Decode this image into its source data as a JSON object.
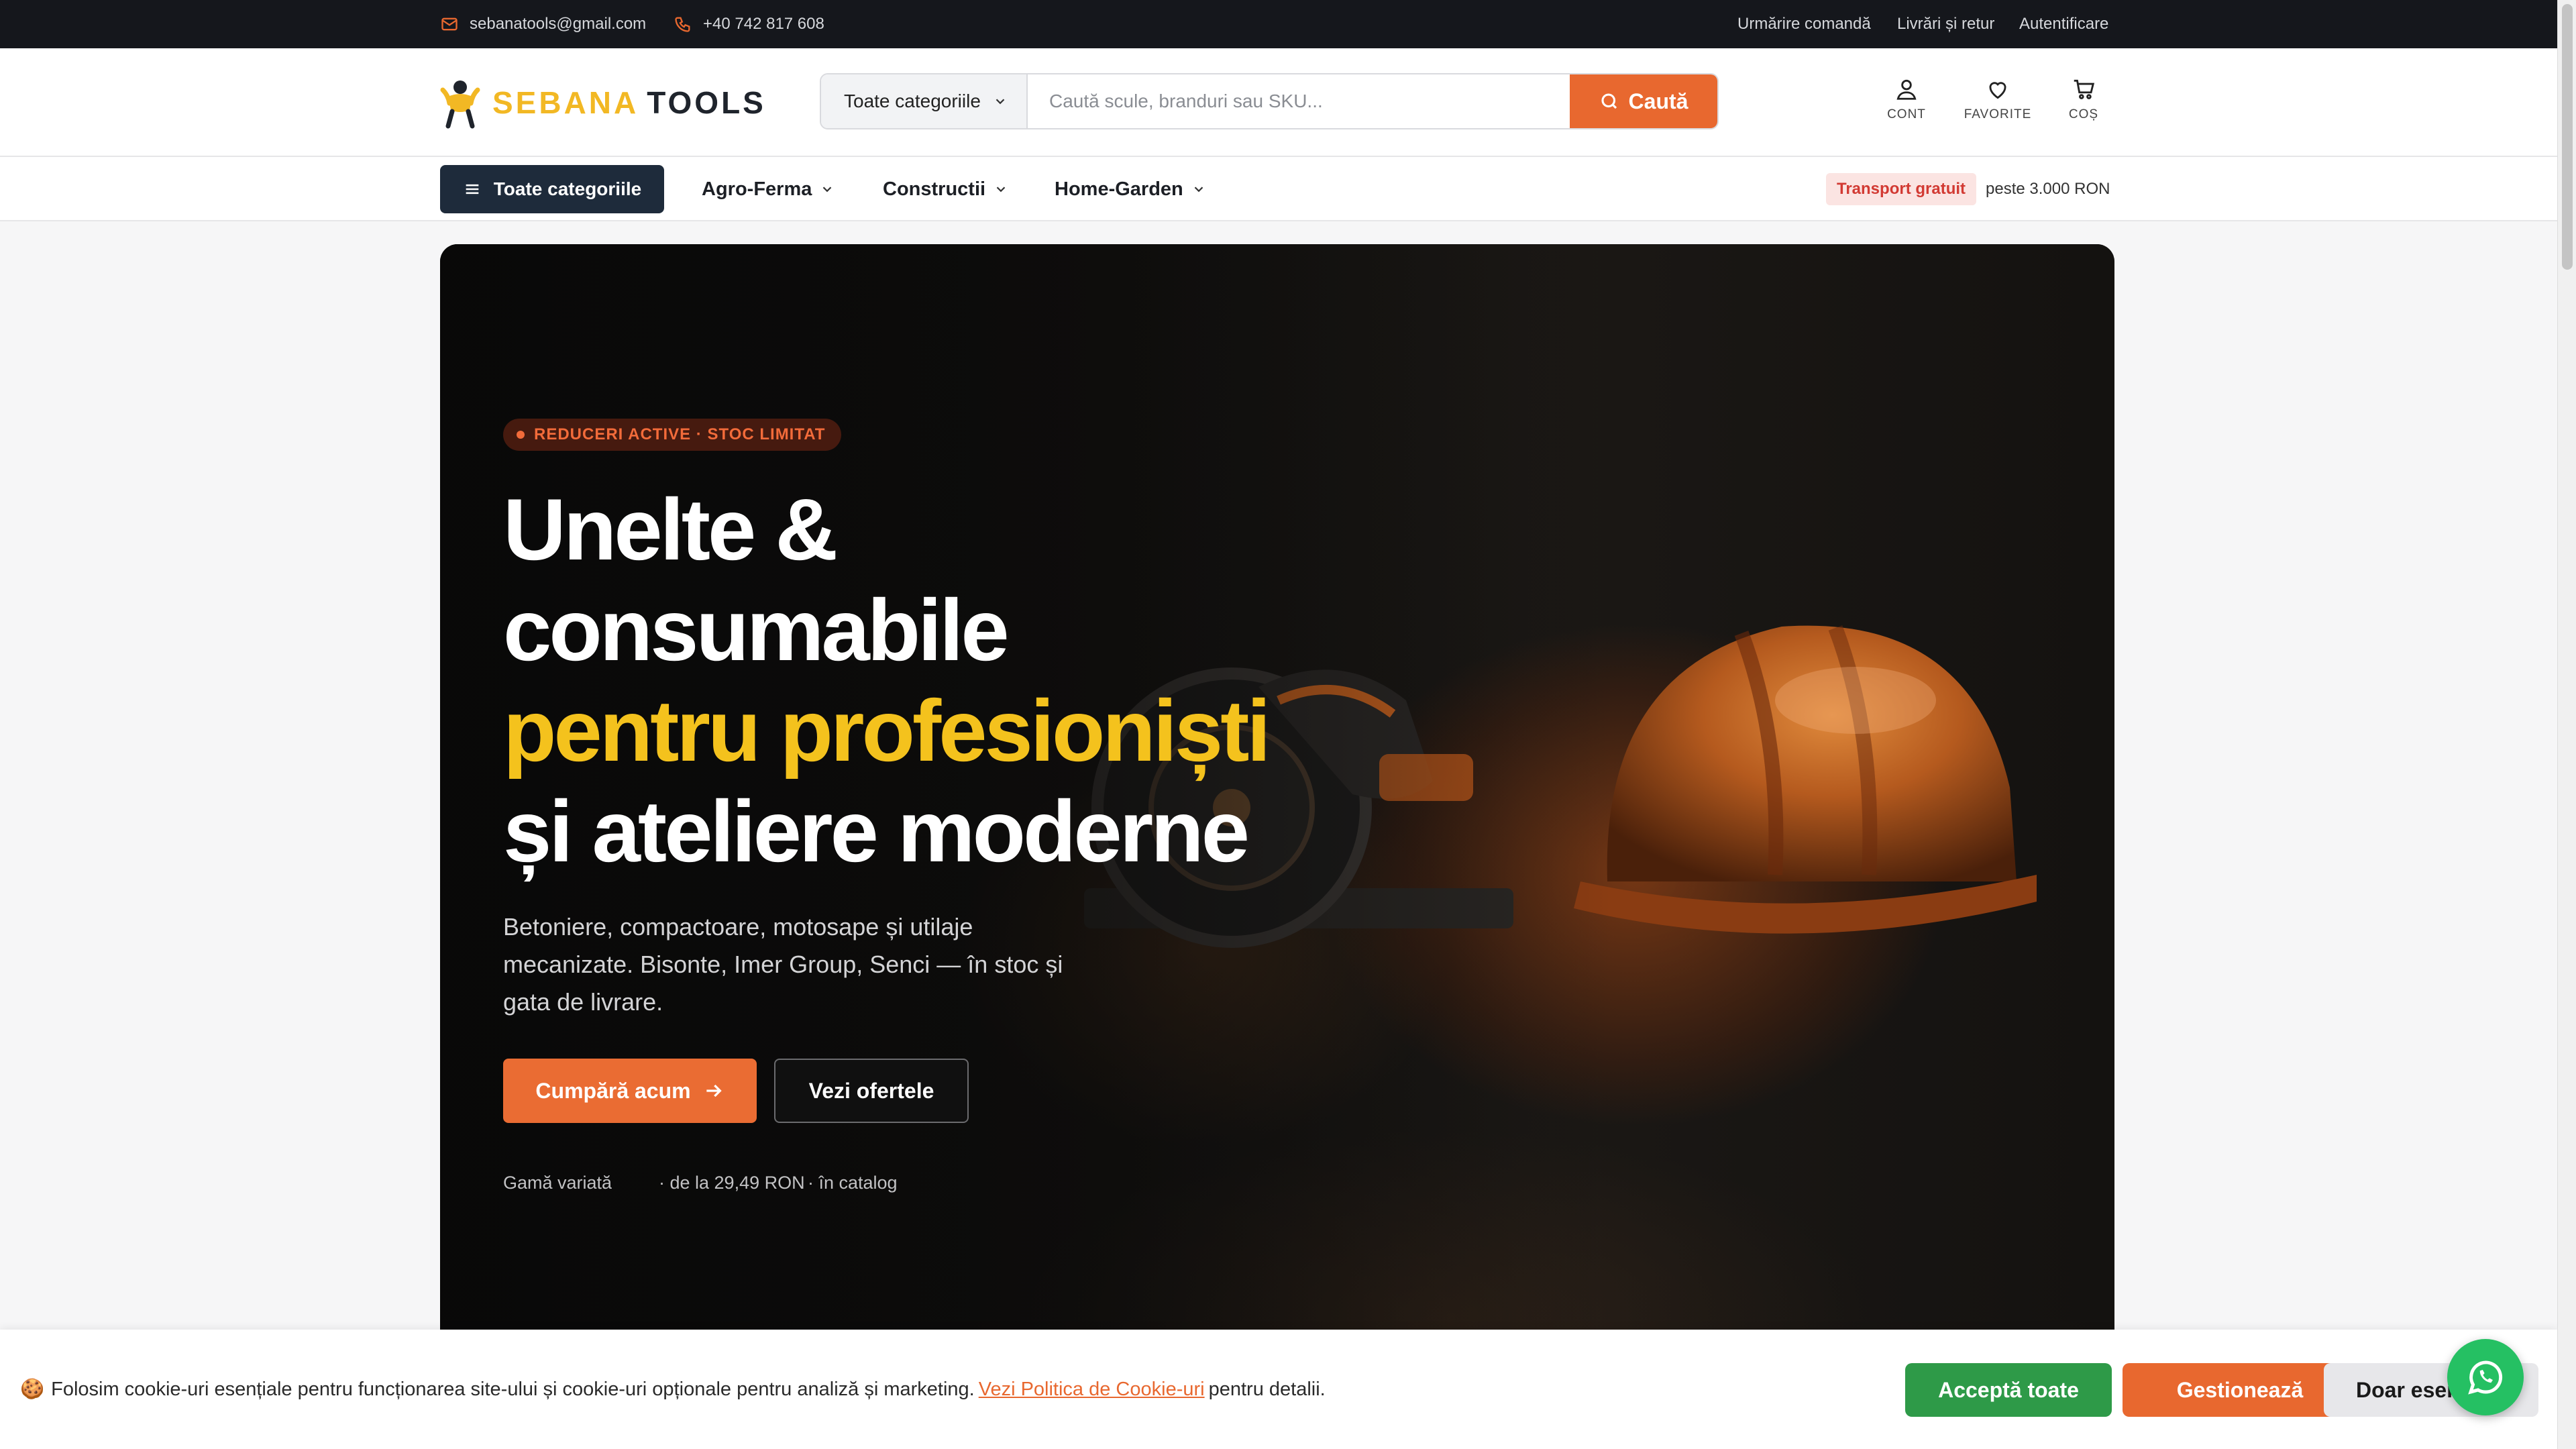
{
  "topbar": {
    "email": "sebanatools@gmail.com",
    "phone": "+40 742 817 608",
    "links": [
      "Urmărire comandă",
      "Livrări și retur",
      "Autentificare"
    ]
  },
  "header": {
    "logo": {
      "part1": "SEBANA",
      "part2": "TOOLS"
    },
    "search": {
      "category": "Toate categoriile",
      "placeholder": "Caută scule, branduri sau SKU...",
      "button": "Caută"
    },
    "icons": {
      "account": "CONT",
      "favorites": "FAVORITE",
      "cart": "COȘ"
    }
  },
  "nav": {
    "all_categories": "Toate categoriile",
    "items": [
      "Agro-Ferma",
      "Constructii",
      "Home-Garden"
    ],
    "shipping_badge": "Transport gratuit",
    "shipping_text": "peste 3.000 RON"
  },
  "hero": {
    "badge": "REDUCERI ACTIVE · STOC LIMITAT",
    "headline": [
      "Unelte &",
      "consumabile",
      "pentru profesioniști",
      "și ateliere moderne"
    ],
    "subtitle": "Betoniere, compactoare, motosape și utilaje mecanizate. Bisonte, Imer Group, Senci — în stoc și gata de livrare.",
    "cta_primary": "Cumpără acum",
    "cta_secondary": "Vezi ofertele",
    "meta": [
      "Gamă variată",
      "· de la 29,49 RON",
      "· în catalog"
    ]
  },
  "cookie": {
    "text_before": "Folosim cookie-uri esențiale pentru funcționarea site-ului și cookie-uri opționale pentru analiză și marketing.",
    "link": "Vezi Politica de Cookie-uri",
    "text_after": "pentru detalii.",
    "accept": "Acceptă toate",
    "manage": "Gestionează",
    "essential": "Doar esențiale"
  },
  "colors": {
    "accent": "#e8682f",
    "navy": "#1e2b3b",
    "yellow": "#f4c21d",
    "green": "#2e9a48",
    "whatsapp": "#25c063"
  },
  "icon_names": [
    "mail-icon",
    "phone-icon",
    "search-icon",
    "user-icon",
    "heart-icon",
    "cart-icon",
    "menu-icon",
    "chevron-down-icon",
    "arrow-right-icon",
    "cookie-icon",
    "whatsapp-icon"
  ]
}
